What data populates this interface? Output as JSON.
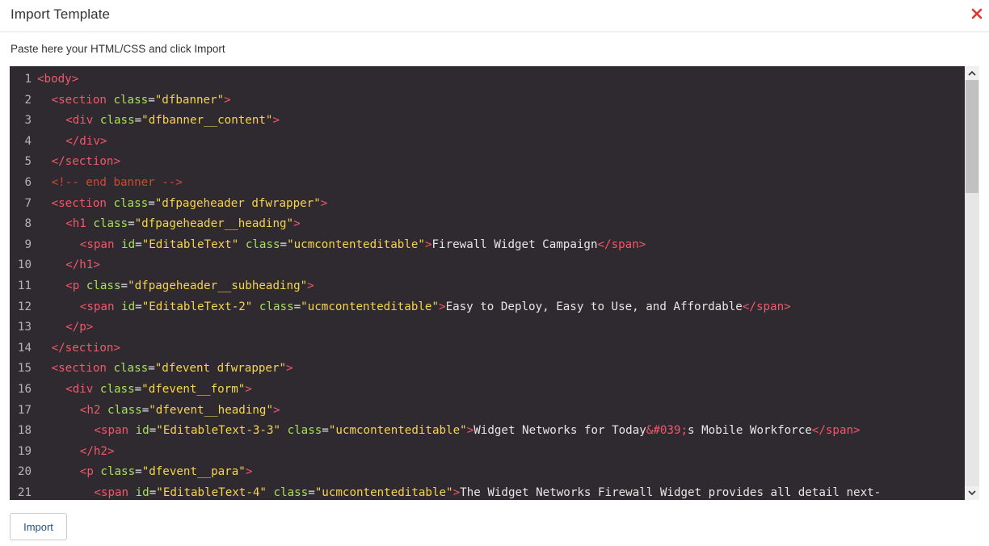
{
  "dialog": {
    "title": "Import Template",
    "close_icon": "close-icon",
    "close_color": "#d9382c",
    "instructions": "Paste here your HTML/CSS and click Import",
    "import_label": "Import"
  },
  "editor": {
    "theme": {
      "background": "#2f2a30",
      "tag": "#f2576b",
      "attr": "#a7e05b",
      "string": "#f6d44d",
      "text": "#e8e6e3",
      "comment": "#cc4a36",
      "gutter": "#b4b4b4"
    },
    "scroll_position": 0.0,
    "lines": [
      {
        "n": "1",
        "indent": 0,
        "tokens": [
          {
            "t": "tag",
            "v": "<body>"
          }
        ]
      },
      {
        "n": "2",
        "indent": 1,
        "tokens": [
          {
            "t": "tag",
            "v": "<section "
          },
          {
            "t": "attr",
            "v": "class"
          },
          {
            "t": "eq",
            "v": "="
          },
          {
            "t": "str",
            "v": "\"dfbanner\""
          },
          {
            "t": "tag",
            "v": ">"
          }
        ]
      },
      {
        "n": "3",
        "indent": 2,
        "tokens": [
          {
            "t": "tag",
            "v": "<div "
          },
          {
            "t": "attr",
            "v": "class"
          },
          {
            "t": "eq",
            "v": "="
          },
          {
            "t": "str",
            "v": "\"dfbanner__content\""
          },
          {
            "t": "tag",
            "v": ">"
          }
        ]
      },
      {
        "n": "4",
        "indent": 2,
        "tokens": [
          {
            "t": "tag",
            "v": "</div>"
          }
        ]
      },
      {
        "n": "5",
        "indent": 1,
        "tokens": [
          {
            "t": "tag",
            "v": "</section>"
          }
        ]
      },
      {
        "n": "6",
        "indent": 1,
        "tokens": [
          {
            "t": "cmt",
            "v": "<!-- end banner -->"
          }
        ]
      },
      {
        "n": "7",
        "indent": 1,
        "tokens": [
          {
            "t": "tag",
            "v": "<section "
          },
          {
            "t": "attr",
            "v": "class"
          },
          {
            "t": "eq",
            "v": "="
          },
          {
            "t": "str",
            "v": "\"dfpageheader dfwrapper\""
          },
          {
            "t": "tag",
            "v": ">"
          }
        ]
      },
      {
        "n": "8",
        "indent": 2,
        "tokens": [
          {
            "t": "tag",
            "v": "<h1 "
          },
          {
            "t": "attr",
            "v": "class"
          },
          {
            "t": "eq",
            "v": "="
          },
          {
            "t": "str",
            "v": "\"dfpageheader__heading\""
          },
          {
            "t": "tag",
            "v": ">"
          }
        ]
      },
      {
        "n": "9",
        "indent": 3,
        "tokens": [
          {
            "t": "tag",
            "v": "<span "
          },
          {
            "t": "attr",
            "v": "id"
          },
          {
            "t": "eq",
            "v": "="
          },
          {
            "t": "str",
            "v": "\"EditableText\""
          },
          {
            "t": "text",
            "v": " "
          },
          {
            "t": "attr",
            "v": "class"
          },
          {
            "t": "eq",
            "v": "="
          },
          {
            "t": "str",
            "v": "\"ucmcontenteditable\""
          },
          {
            "t": "tag",
            "v": ">"
          },
          {
            "t": "text",
            "v": "Firewall Widget Campaign"
          },
          {
            "t": "tag",
            "v": "</span>"
          }
        ]
      },
      {
        "n": "10",
        "indent": 2,
        "tokens": [
          {
            "t": "tag",
            "v": "</h1>"
          }
        ]
      },
      {
        "n": "11",
        "indent": 2,
        "tokens": [
          {
            "t": "tag",
            "v": "<p "
          },
          {
            "t": "attr",
            "v": "class"
          },
          {
            "t": "eq",
            "v": "="
          },
          {
            "t": "str",
            "v": "\"dfpageheader__subheading\""
          },
          {
            "t": "tag",
            "v": ">"
          }
        ]
      },
      {
        "n": "12",
        "indent": 3,
        "tokens": [
          {
            "t": "tag",
            "v": "<span "
          },
          {
            "t": "attr",
            "v": "id"
          },
          {
            "t": "eq",
            "v": "="
          },
          {
            "t": "str",
            "v": "\"EditableText-2\""
          },
          {
            "t": "text",
            "v": " "
          },
          {
            "t": "attr",
            "v": "class"
          },
          {
            "t": "eq",
            "v": "="
          },
          {
            "t": "str",
            "v": "\"ucmcontenteditable\""
          },
          {
            "t": "tag",
            "v": ">"
          },
          {
            "t": "text",
            "v": "Easy to Deploy, Easy to Use, and Affordable"
          },
          {
            "t": "tag",
            "v": "</span>"
          }
        ]
      },
      {
        "n": "13",
        "indent": 2,
        "tokens": [
          {
            "t": "tag",
            "v": "</p>"
          }
        ]
      },
      {
        "n": "14",
        "indent": 1,
        "tokens": [
          {
            "t": "tag",
            "v": "</section>"
          }
        ]
      },
      {
        "n": "15",
        "indent": 1,
        "tokens": [
          {
            "t": "tag",
            "v": "<section "
          },
          {
            "t": "attr",
            "v": "class"
          },
          {
            "t": "eq",
            "v": "="
          },
          {
            "t": "str",
            "v": "\"dfevent dfwrapper\""
          },
          {
            "t": "tag",
            "v": ">"
          }
        ]
      },
      {
        "n": "16",
        "indent": 2,
        "tokens": [
          {
            "t": "tag",
            "v": "<div "
          },
          {
            "t": "attr",
            "v": "class"
          },
          {
            "t": "eq",
            "v": "="
          },
          {
            "t": "str",
            "v": "\"dfevent__form\""
          },
          {
            "t": "tag",
            "v": ">"
          }
        ]
      },
      {
        "n": "17",
        "indent": 3,
        "tokens": [
          {
            "t": "tag",
            "v": "<h2 "
          },
          {
            "t": "attr",
            "v": "class"
          },
          {
            "t": "eq",
            "v": "="
          },
          {
            "t": "str",
            "v": "\"dfevent__heading\""
          },
          {
            "t": "tag",
            "v": ">"
          }
        ]
      },
      {
        "n": "18",
        "indent": 4,
        "tokens": [
          {
            "t": "tag",
            "v": "<span "
          },
          {
            "t": "attr",
            "v": "id"
          },
          {
            "t": "eq",
            "v": "="
          },
          {
            "t": "str",
            "v": "\"EditableText-3-3\""
          },
          {
            "t": "text",
            "v": " "
          },
          {
            "t": "attr",
            "v": "class"
          },
          {
            "t": "eq",
            "v": "="
          },
          {
            "t": "str",
            "v": "\"ucmcontenteditable\""
          },
          {
            "t": "tag",
            "v": ">"
          },
          {
            "t": "text",
            "v": "Widget Networks for Today"
          },
          {
            "t": "tag",
            "v": "&#039;"
          },
          {
            "t": "text",
            "v": "s Mobile Workforce"
          },
          {
            "t": "tag",
            "v": "</span>"
          }
        ]
      },
      {
        "n": "19",
        "indent": 3,
        "tokens": [
          {
            "t": "tag",
            "v": "</h2>"
          }
        ]
      },
      {
        "n": "20",
        "indent": 3,
        "tokens": [
          {
            "t": "tag",
            "v": "<p "
          },
          {
            "t": "attr",
            "v": "class"
          },
          {
            "t": "eq",
            "v": "="
          },
          {
            "t": "str",
            "v": "\"dfevent__para\""
          },
          {
            "t": "tag",
            "v": ">"
          }
        ]
      },
      {
        "n": "21",
        "indent": 4,
        "tokens": [
          {
            "t": "tag",
            "v": "<span "
          },
          {
            "t": "attr",
            "v": "id"
          },
          {
            "t": "eq",
            "v": "="
          },
          {
            "t": "str",
            "v": "\"EditableText-4\""
          },
          {
            "t": "text",
            "v": " "
          },
          {
            "t": "attr",
            "v": "class"
          },
          {
            "t": "eq",
            "v": "="
          },
          {
            "t": "str",
            "v": "\"ucmcontenteditable\""
          },
          {
            "t": "tag",
            "v": ">"
          },
          {
            "t": "text",
            "v": "The Widget Networks Firewall Widget provides all detail next-"
          }
        ]
      }
    ]
  }
}
